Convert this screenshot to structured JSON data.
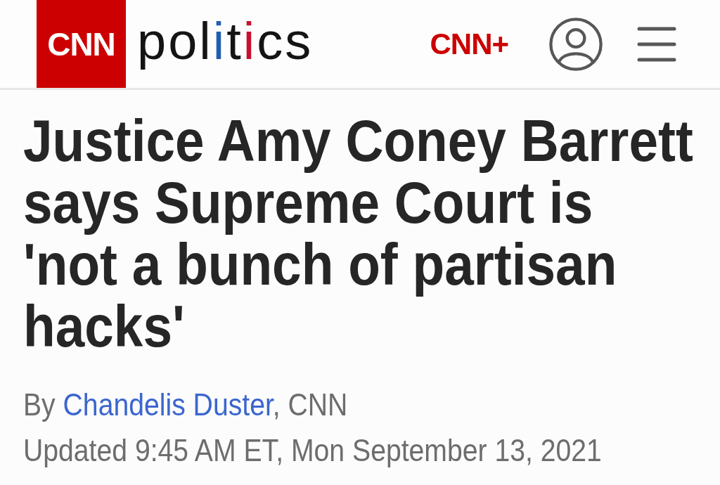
{
  "header": {
    "brand_logo": "CNN",
    "section_wordmark": [
      {
        "text": "pol",
        "color": "#141414"
      },
      {
        "text": "i",
        "color": "#1f5fae"
      },
      {
        "text": "t",
        "color": "#141414"
      },
      {
        "text": "i",
        "color": "#c8102e"
      },
      {
        "text": "cs",
        "color": "#141414"
      }
    ],
    "subscription_logo": "CNN+"
  },
  "article": {
    "headline": "Justice Amy Coney Barrett says Supreme Court is 'not a bunch of partisan hacks'",
    "byline": {
      "prefix": "By",
      "author": "Chandelis Duster",
      "suffix": ", CNN"
    },
    "timestamp": "Updated 9:45 AM ET, Mon September 13, 2021"
  }
}
